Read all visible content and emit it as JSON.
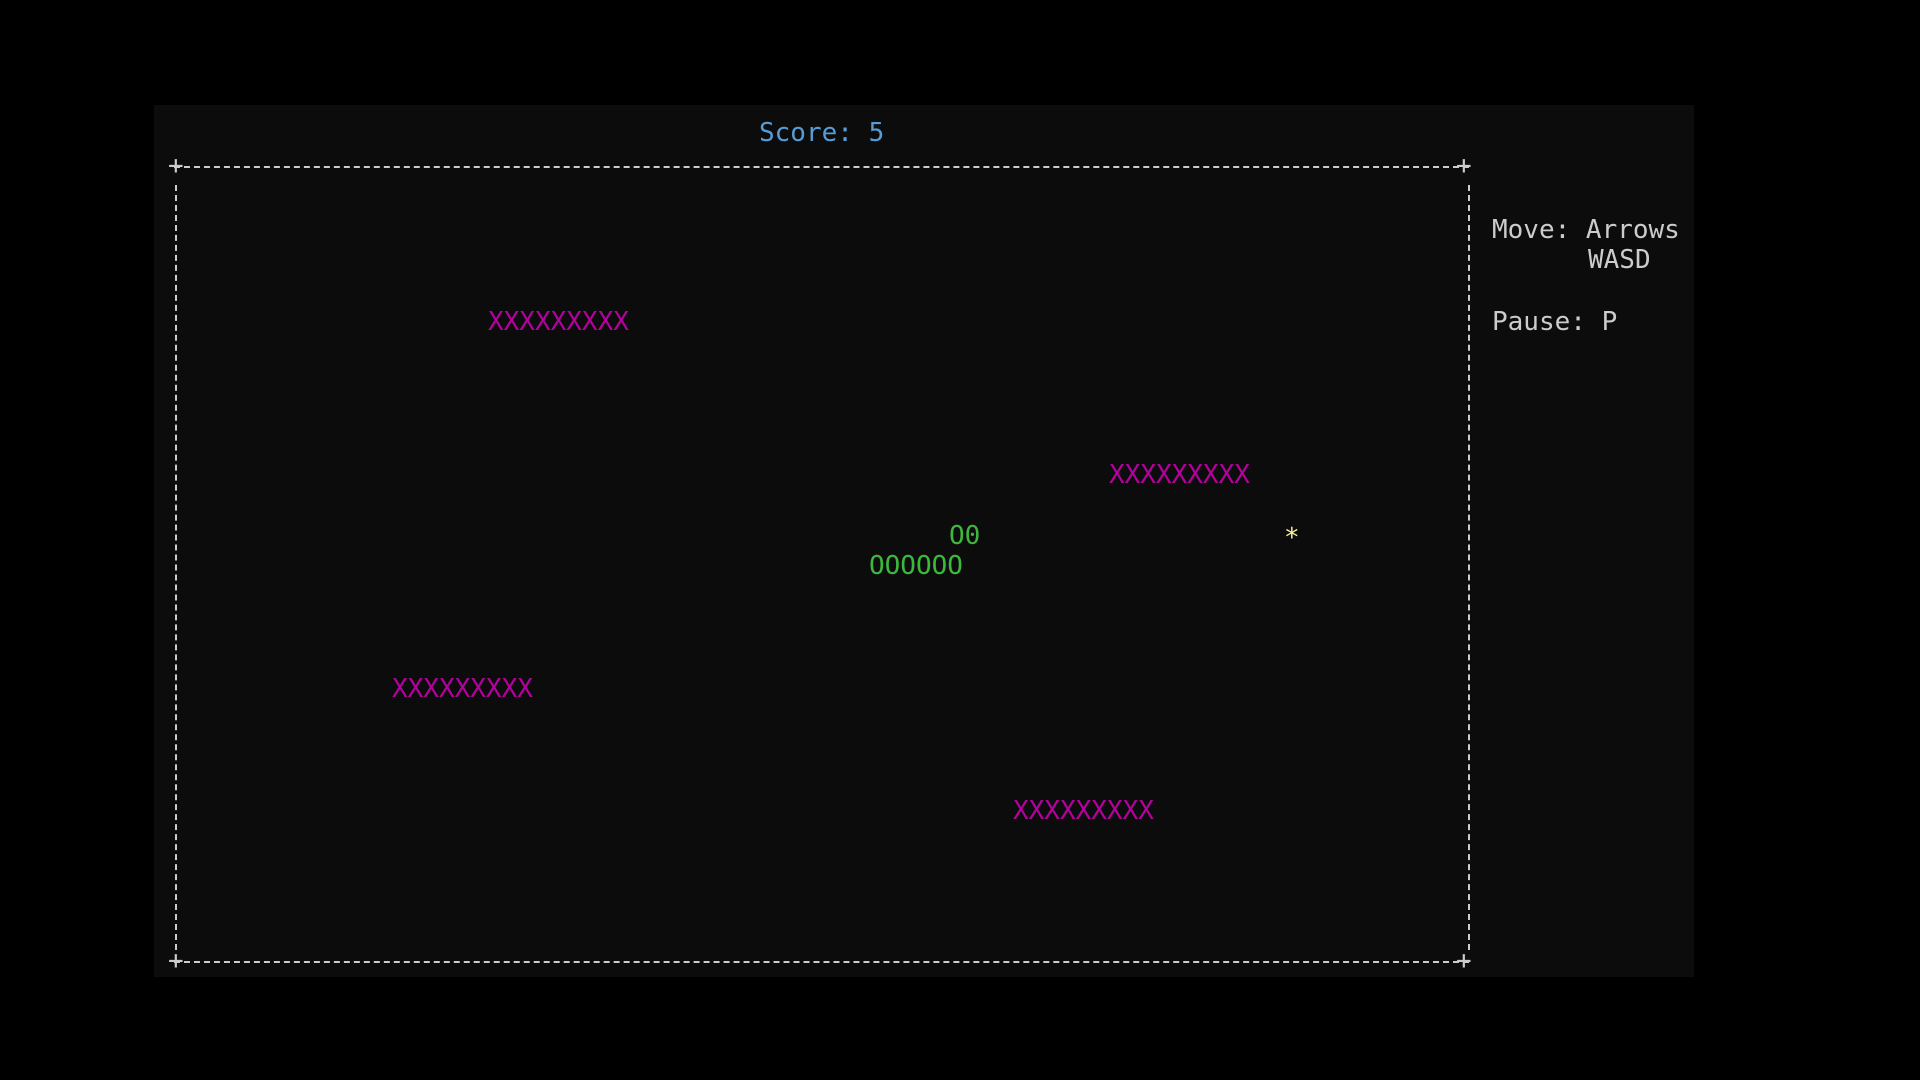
{
  "hud": {
    "score_text": "Score: 5"
  },
  "help": {
    "move_label": "Move: Arrows",
    "move_alt": "WASD",
    "pause_label": "Pause: P"
  },
  "board": {
    "walls": [
      "XXXXXXXXX",
      "XXXXXXXXX",
      "XXXXXXXXX",
      "XXXXXXXXX"
    ],
    "snake_head": "O0",
    "snake_body": "OOOOOO",
    "food": "*",
    "corner_glyph": "+"
  },
  "colors": {
    "score": "#569cd6",
    "wall": "#b4009e",
    "snake": "#3cb83c",
    "food": "#f9f1a5",
    "border": "#cccccc",
    "background": "#0c0c0c"
  }
}
